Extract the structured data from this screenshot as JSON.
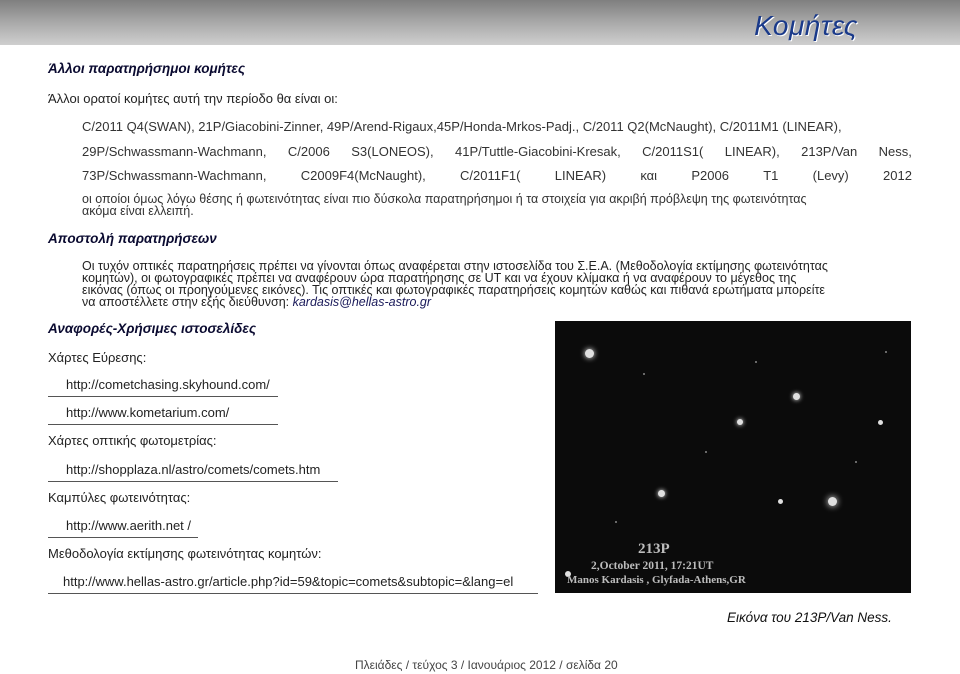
{
  "header": {
    "title": "Κομήτες"
  },
  "sections": {
    "other_observable": {
      "heading": "Άλλοι παρατηρήσημοι κομήτες",
      "intro": "Άλλοι ορατοί κομήτες αυτή την περίοδο θα είναι οι:",
      "row1": "C/2011 Q4(SWAN), 21P/Giacobini-Zinner, 49P/Arend-Rigaux,45P/Honda-Mrkos-Padj., C/2011 Q2(McNaught), C/2011M1 (LINEAR),",
      "row2": [
        "29P/Schwassmann-Wachmann,",
        "C/2006",
        "S3(LONEOS),",
        "41P/Tuttle-Giacobini-Kresak,",
        "C/2011S1(",
        "LINEAR),",
        "213P/Van",
        "Ness,"
      ],
      "row3": [
        "73P/Schwassmann-Wachmann,",
        "C2009F4(McNaught),",
        "C/2011F1(",
        "LINEAR)",
        "και",
        "P2006",
        "T1",
        "(Levy)",
        "2012"
      ],
      "note_line1": "οι οποίοι όμως λόγω θέσης ή φωτεινότητας είναι πιο δύσκολα παρατηρήσημοι ή τα στοιχεία για ακριβή πρόβλεψη της φωτεινότητας",
      "note_line2": "ακόμα είναι ελλειπή."
    },
    "submission": {
      "heading": "Αποστολή παρατηρήσεων",
      "p_line1": "Οι τυχόν οπτικές παρατηρήσεις πρέπει να γίνονται όπως αναφέρεται στην ιστοσελίδα του Σ.Ε.Α. (Μεθοδολογία εκτίμησης φωτεινότητας",
      "p_line2": "κομητών), οι φωτογραφικές πρέπει να αναφέρουν ώρα παρατήρησης σε UT και να έχουν κλίμακα ή να αναφέρουν το μέγεθος της",
      "p_line3": "εικόνας (όπως οι προηγούμενες εικόνες). Τις οπτικές και φωτογραφικές παρατηρήσεις κομητών καθώς και πιθανά ερωτήματα μπορείτε",
      "p_line4": "να αποστέλλετε στην εξής διεύθυνση:",
      "email": "kardasis@hellas-astro.gr"
    },
    "references": {
      "heading": "Αναφορές-Χρήσιμες ιστοσελίδες",
      "groups": [
        {
          "label": "Χάρτες Εύρεσης:",
          "links": [
            "http://cometchasing.skyhound.com/",
            "http://www.kometarium.com/"
          ]
        },
        {
          "label": "Χάρτες οπτικής φωτομετρίας:",
          "links": [
            "http://shopplaza.nl/astro/comets/comets.htm"
          ]
        },
        {
          "label": "Καμπύλες φωτεινότητας:",
          "links": [
            "http://www.aerith.net /"
          ]
        },
        {
          "label": "Μεθοδολογία εκτίμησης φωτεινότητας κομητών:",
          "links": [
            "http://www.hellas-astro.gr/article.php?id=59&topic=comets&subtopic=&lang=el"
          ]
        }
      ]
    }
  },
  "photo": {
    "title": "213P",
    "date": "2,October 2011, 17:21UT",
    "credit": "Manos Kardasis , Glyfada-Athens,GR",
    "caption": "Εικόνα του 213P/Van Ness."
  },
  "footer": {
    "text": "Πλειάδες / τεύχος 3 / Ιανουάριος 2012 / σελίδα 20"
  },
  "colors": {
    "title": "#1a3a8a",
    "heading": "#0a0a30",
    "header_band": "#a9a9a9"
  }
}
